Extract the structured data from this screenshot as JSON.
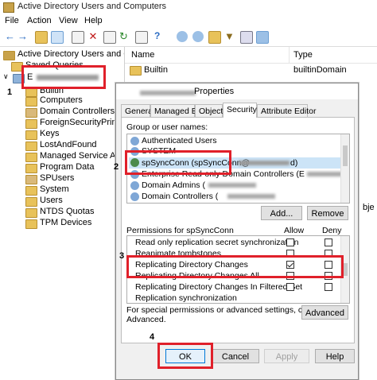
{
  "window": {
    "title": "Active Directory Users and Computers"
  },
  "menu": [
    "File",
    "Action",
    "View",
    "Help"
  ],
  "tree": {
    "root": "Active Directory Users and Com",
    "saved_queries": "Saved Queries",
    "domain": "E",
    "items": [
      "Builtin",
      "Computers",
      "Domain Controllers",
      "ForeignSecurityPrincip",
      "Keys",
      "LostAndFound",
      "Managed Service Acc",
      "Program Data",
      "SPUsers",
      "System",
      "Users",
      "NTDS Quotas",
      "TPM Devices"
    ]
  },
  "list": {
    "col_name": "Name",
    "col_type": "Type",
    "rows": [
      {
        "name": "Builtin",
        "type": "builtinDomain"
      }
    ],
    "partial_right": "bje"
  },
  "dialog": {
    "title": "Properties",
    "tabs": [
      "General",
      "Managed By",
      "Object",
      "Security",
      "Attribute Editor"
    ],
    "group_label": "Group or user names:",
    "users": [
      "Authenticated Users",
      "SYSTEM",
      "spSyncConn (spSyncConn@",
      "Enterprise Read-only Domain Controllers (E",
      "Domain Admins (",
      "Domain Controllers ("
    ],
    "users_tail": [
      "d)",
      ""
    ],
    "add_button": "Add...",
    "remove_button": "Remove",
    "perm_label": "Permissions for spSyncConn",
    "allow_label": "Allow",
    "deny_label": "Deny",
    "permissions": [
      "Read only replication secret synchronization",
      "Reanimate tombstones",
      "Replicating Directory Changes",
      "Replicating Directory Changes All",
      "Replicating Directory Changes In Filtered Set",
      "Replication synchronization"
    ],
    "special_text_1": "For special permissions or advanced settings, click",
    "special_text_2": "Advanced.",
    "advanced_button": "Advanced",
    "ok_button": "OK",
    "cancel_button": "Cancel",
    "apply_button": "Apply",
    "help_button": "Help"
  },
  "annotations": [
    "1",
    "2",
    "3",
    "4"
  ],
  "colors": {
    "highlight": "#e0202a",
    "folder": "#e8c25a"
  }
}
